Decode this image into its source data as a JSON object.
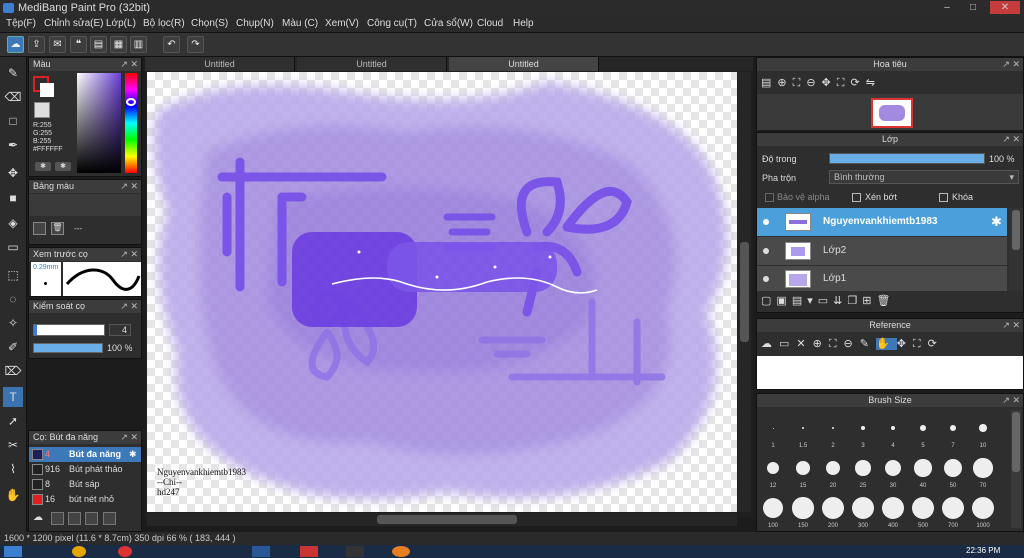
{
  "app": {
    "title": "MediBang Paint Pro (32bit)"
  },
  "window_controls": {
    "minimize": "–",
    "maximize": "□",
    "close": "✕"
  },
  "menu": [
    "Tệp(F)",
    "Chỉnh sửa(E)",
    "Lớp(L)",
    "Bộ lọc(R)",
    "Chọn(S)",
    "Chụp(N)",
    "Màu (C)",
    "Xem(V)",
    "Công cụ(T)",
    "Cửa sổ(W)",
    "Cloud",
    "Help"
  ],
  "tabs": [
    "Untitled",
    "Untitled",
    "Untitled"
  ],
  "color_panel": {
    "title": "Màu",
    "r": "R:255",
    "g": "G:255",
    "b": "B:255",
    "hex": "#FFFFFF",
    "primary": "#e02020",
    "secondary": "#ffffff"
  },
  "palette_panel": {
    "title": "Bảng màu",
    "value": "---"
  },
  "preview_panel": {
    "title": "Xem trước cọ",
    "size": "0.29mm"
  },
  "control_panel": {
    "title": "Kiểm soát cọ",
    "size": "4",
    "opacity": "100 %"
  },
  "brush_panel": {
    "title": "Cọ: Bút đa năng",
    "items": [
      {
        "size": "4",
        "name": "Bút đa năng",
        "color": "#1e1e5a",
        "selected": true
      },
      {
        "size": "916",
        "name": "Bút phát thảo",
        "color": "#222",
        "selected": false
      },
      {
        "size": "8",
        "name": "Bút sáp",
        "color": "#222",
        "selected": false
      },
      {
        "size": "16",
        "name": "bút nét nhỏ",
        "color": "#e02020",
        "selected": false
      }
    ]
  },
  "canvas": {
    "sig1": "Nguyenvankhiemtb1983",
    "sig2": "--Chi--",
    "sig3": "hd247"
  },
  "navigator": {
    "title": "Hoa tiêu"
  },
  "layers": {
    "title": "Lớp",
    "opacity_label": "Độ trong",
    "opacity_value": "100 %",
    "blend_label": "Pha trộn",
    "blend_value": "Bình thường",
    "protect_alpha": "Bảo vệ alpha",
    "clipping": "Xén bớt",
    "lock": "Khóa",
    "items": [
      {
        "name": "Nguyenvankhiemtb1983",
        "selected": true
      },
      {
        "name": "Lớp2",
        "selected": false
      },
      {
        "name": "Lớp1",
        "selected": false
      }
    ]
  },
  "reference": {
    "title": "Reference"
  },
  "brush_size": {
    "title": "Brush Size",
    "sizes": [
      "1",
      "1.5",
      "2",
      "3",
      "4",
      "5",
      "7",
      "10",
      "12",
      "15",
      "20",
      "25",
      "30",
      "40",
      "50",
      "70",
      "100",
      "150",
      "200",
      "300",
      "400",
      "500",
      "700",
      "1000"
    ]
  },
  "status": {
    "text": "1600 * 1200 pixel  (11.6 * 8.7cm)  350 dpi  66 %  ( 183, 444 )"
  },
  "taskbar": {
    "clock": "22:36 PM"
  }
}
